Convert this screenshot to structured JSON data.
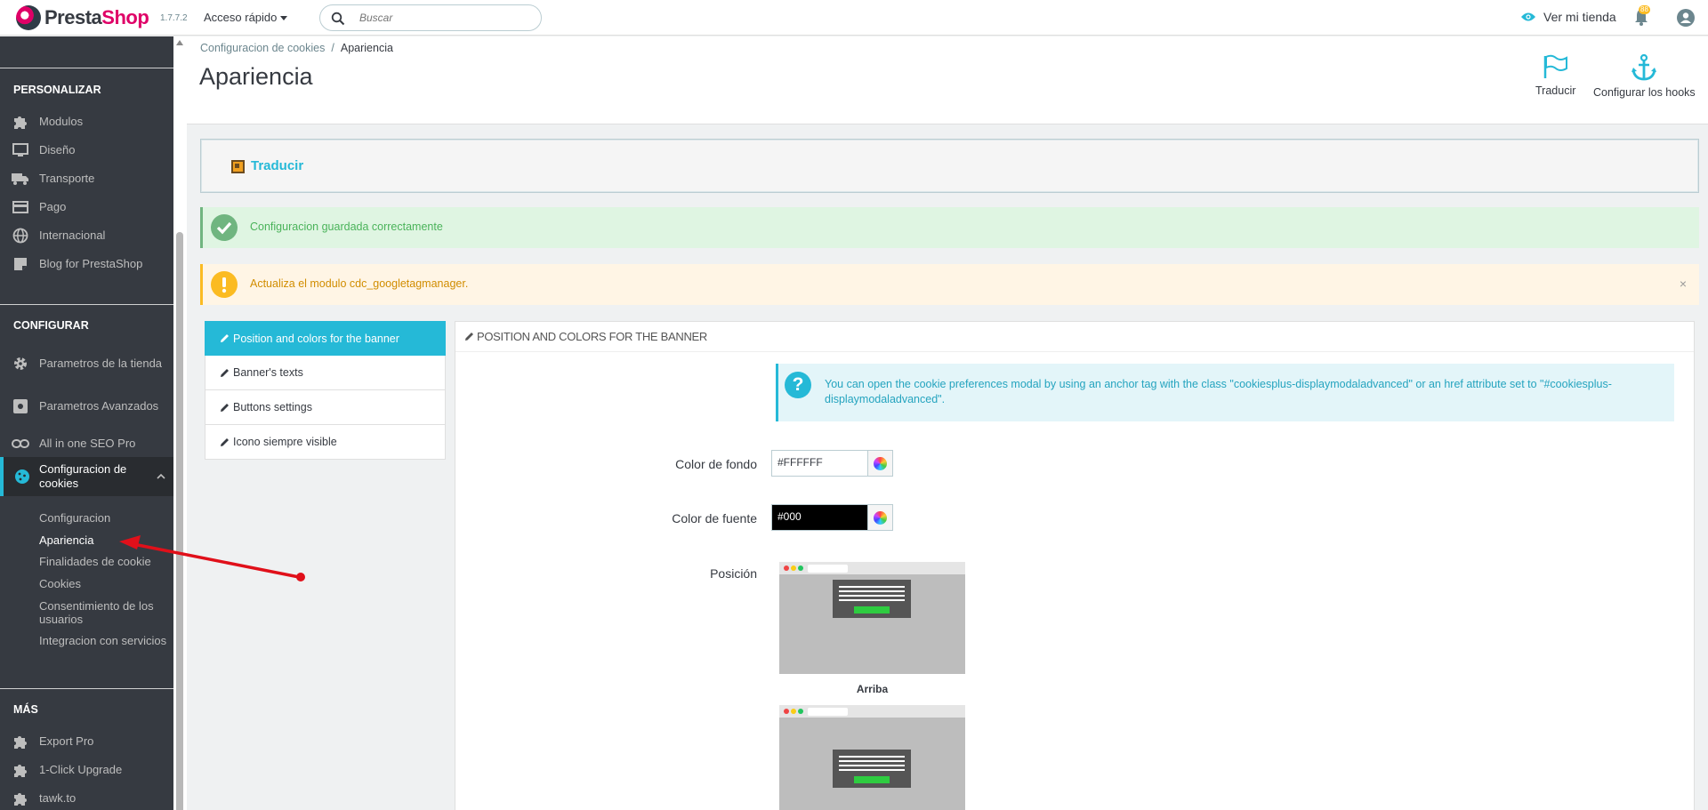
{
  "topbar": {
    "logo_brand_a": "Presta",
    "logo_brand_b": "Shop",
    "version": "1.7.7.2",
    "quick_access": "Acceso rápido",
    "search_placeholder": "Buscar",
    "view_shop": "Ver mi tienda",
    "notifications_count": "88"
  },
  "sidebar": {
    "section_personalizar": "PERSONALIZAR",
    "section_configurar": "CONFIGURAR",
    "section_mas": "MÁS",
    "personalizar_items": [
      {
        "label": "Modulos",
        "icon": "puzzle-icon"
      },
      {
        "label": "Diseño",
        "icon": "monitor-icon"
      },
      {
        "label": "Transporte",
        "icon": "truck-icon"
      },
      {
        "label": "Pago",
        "icon": "credit-card-icon"
      },
      {
        "label": "Internacional",
        "icon": "globe-icon"
      },
      {
        "label": "Blog for PrestaShop",
        "icon": "note-icon"
      }
    ],
    "configurar_items": [
      {
        "label": "Parametros de la tienda",
        "icon": "gear-icon"
      },
      {
        "label": "Parametros Avanzados",
        "icon": "advanced-gear-icon"
      },
      {
        "label": "All in one SEO Pro",
        "icon": "link-icon"
      },
      {
        "label": "Configuracion de cookies",
        "icon": "cookie-icon"
      }
    ],
    "cookies_subitems": [
      "Configuracion",
      "Apariencia",
      "Finalidades de cookie",
      "Cookies",
      "Consentimiento de los usuarios",
      "Integracion con servicios"
    ],
    "mas_items": [
      {
        "label": "Export Pro",
        "icon": "puzzle-icon"
      },
      {
        "label": "1-Click Upgrade",
        "icon": "puzzle-icon"
      },
      {
        "label": "tawk.to",
        "icon": "puzzle-icon"
      }
    ]
  },
  "header": {
    "breadcrumb_parent": "Configuracion de cookies",
    "breadcrumb_separator": "/",
    "breadcrumb_current": "Apariencia",
    "title": "Apariencia",
    "toolbar_translate": "Traducir",
    "toolbar_hooks": "Configurar los hooks"
  },
  "translate_panel": {
    "label": "Traducir"
  },
  "alerts": {
    "success": "Configuracion guardada correctamente",
    "warning": "Actualiza el modulo cdc_googletagmanager.",
    "close": "×"
  },
  "tabs": [
    {
      "label": "Position and colors for the banner",
      "active": true
    },
    {
      "label": "Banner's texts",
      "active": false
    },
    {
      "label": "Buttons settings",
      "active": false
    },
    {
      "label": "Icono siempre visible",
      "active": false
    }
  ],
  "form": {
    "panel_title": "POSITION AND COLORS FOR THE BANNER",
    "info_text": "You can open the cookie preferences modal by using an anchor tag with the class \"cookiesplus-displaymodaladvanced\" or an href attribute set to \"#cookiesplus-displaymodaladvanced\".",
    "bg_color_label": "Color de fondo",
    "bg_color_value": "#FFFFFF",
    "font_color_label": "Color de fuente",
    "font_color_value": "#000",
    "position_label": "Posición",
    "position_option_top": "Arriba"
  },
  "colors": {
    "accent": "#25b9d7",
    "sidebar_bg": "#363a41",
    "success": "#70b580",
    "warning": "#fbbb22",
    "brand_pink": "#df0067",
    "annotation_red": "#e0101a"
  }
}
